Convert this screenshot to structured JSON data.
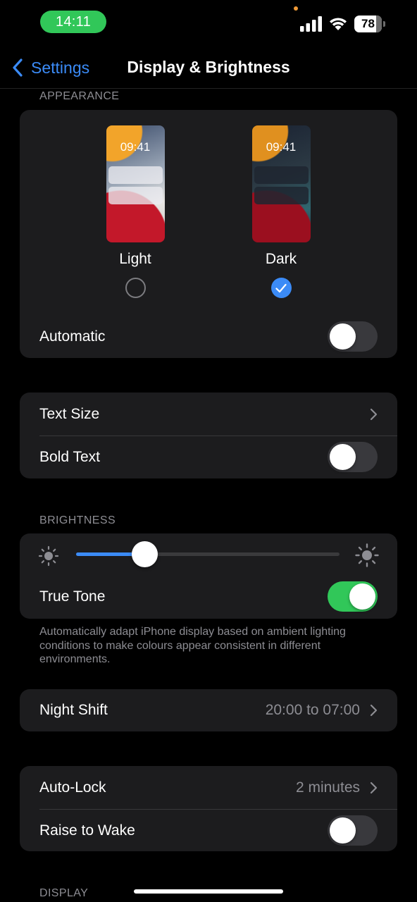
{
  "status_bar": {
    "time": "14:11",
    "battery": "78",
    "signal_icon": "cellular-signal-icon",
    "wifi_icon": "wifi-icon"
  },
  "nav": {
    "back_label": "Settings",
    "title": "Display & Brightness"
  },
  "appearance": {
    "header": "APPEARANCE",
    "light": {
      "label": "Light",
      "preview_time": "09:41",
      "selected": false
    },
    "dark": {
      "label": "Dark",
      "preview_time": "09:41",
      "selected": true
    },
    "automatic_label": "Automatic",
    "automatic_on": false
  },
  "text": {
    "text_size_label": "Text Size",
    "bold_text_label": "Bold Text",
    "bold_text_on": false
  },
  "brightness": {
    "header": "BRIGHTNESS",
    "level": 0.26,
    "true_tone_label": "True Tone",
    "true_tone_on": true,
    "footnote": "Automatically adapt iPhone display based on ambient lighting conditions to make colours appear consistent in different environments."
  },
  "night_shift": {
    "label": "Night Shift",
    "value": "20:00 to 07:00"
  },
  "lock": {
    "auto_lock_label": "Auto-Lock",
    "auto_lock_value": "2 minutes",
    "raise_to_wake_label": "Raise to Wake",
    "raise_to_wake_on": false
  },
  "display": {
    "header": "DISPLAY"
  },
  "colors": {
    "accent": "#3b8bf7",
    "toggle_on": "#31c759",
    "cell": "#1c1c1e"
  }
}
